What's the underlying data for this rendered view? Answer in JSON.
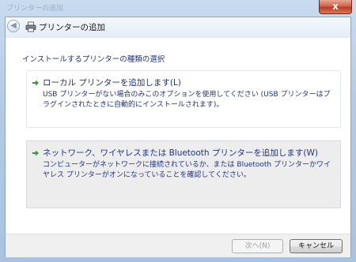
{
  "window": {
    "title": "プリンターの追加",
    "close_glyph": "x"
  },
  "header": {
    "back_glyph": "◀",
    "title": "プリンターの追加"
  },
  "instruction": "インストールするプリンターの種類の選択",
  "options": [
    {
      "title": "ローカル プリンターを追加します(L)",
      "description": "USB プリンターがない場合のみこのオプションを使用してください (USB プリンターはプラグインされたときに自動的にインストールされます)。",
      "icon": "green-arrow-icon"
    },
    {
      "title": "ネットワーク、ワイヤレスまたは Bluetooth プリンターを追加します(W)",
      "description": "コンピューターがネットワークに接続されているか、または Bluetooth プリンターかワイヤレス プリンターがオンになっていることを確認してください。",
      "icon": "green-arrow-icon"
    }
  ],
  "buttons": {
    "next": "次へ(N)",
    "cancel": "キャンセル"
  },
  "colors": {
    "accent_text": "#1e3287",
    "close_button": "#c94c30",
    "arrow_green": "#2f9e2f"
  }
}
